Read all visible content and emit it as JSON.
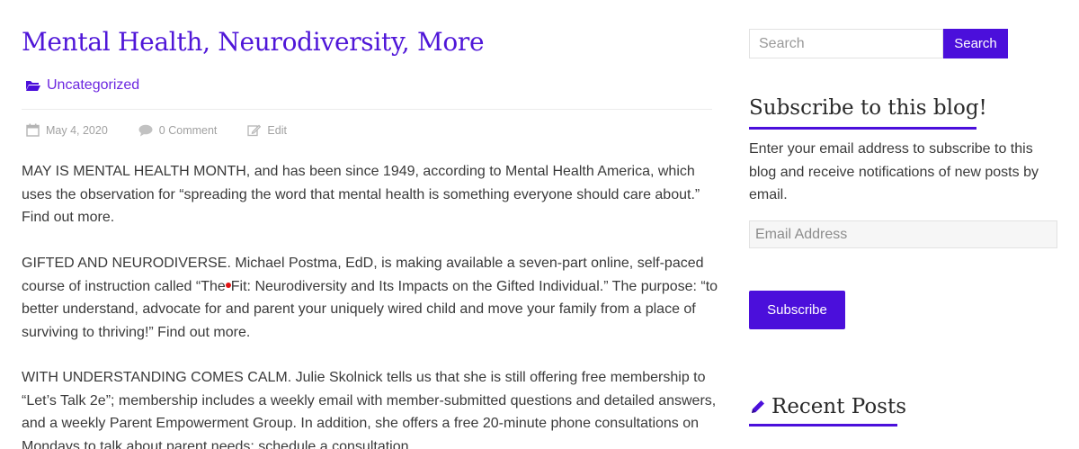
{
  "post": {
    "title": "Mental Health, Neurodiversity, More",
    "category": "Uncategorized",
    "date": "May 4, 2020",
    "comments": "0 Comment",
    "edit": "Edit",
    "p1": "MAY IS MENTAL HEALTH MONTH, and has been since 1949, according to Mental Health America, which uses the observation for “spreading the word that mental health is something everyone should care about.” Find out more.",
    "p2_before": "GIFTED AND NEURODIVERSE. Michael Postma, EdD, is making available a seven-part online, self-paced course of instruction called “The",
    "p2_after": "Fit: Neurodiversity and Its Impacts on the Gifted Individual.” The purpose: “to better understand, advocate for and parent your uniquely wired child and move your family from a place of surviving to thriving!” Find out more.",
    "p3": "WITH UNDERSTANDING COMES CALM. Julie Skolnick tells us that she is still offering free membership to “Let’s Talk 2e”; membership includes a weekly email with member-submitted questions and detailed answers, and a weekly Parent Empowerment Group. In addition, she offers a free 20-minute phone consultations on Mondays to talk about parent needs; schedule a consultation."
  },
  "sidebar": {
    "search_placeholder": "Search",
    "search_button": "Search",
    "subscribe_title": "Subscribe to this blog!",
    "subscribe_desc": "Enter your email address to subscribe to this blog and receive notifications of new posts by email.",
    "email_placeholder": "Email Address",
    "subscribe_button": "Subscribe",
    "recent_title": "Recent Posts"
  },
  "colors": {
    "accent": "#4b0fdb",
    "title": "#4f16d8",
    "meta": "#a1a1a1"
  }
}
